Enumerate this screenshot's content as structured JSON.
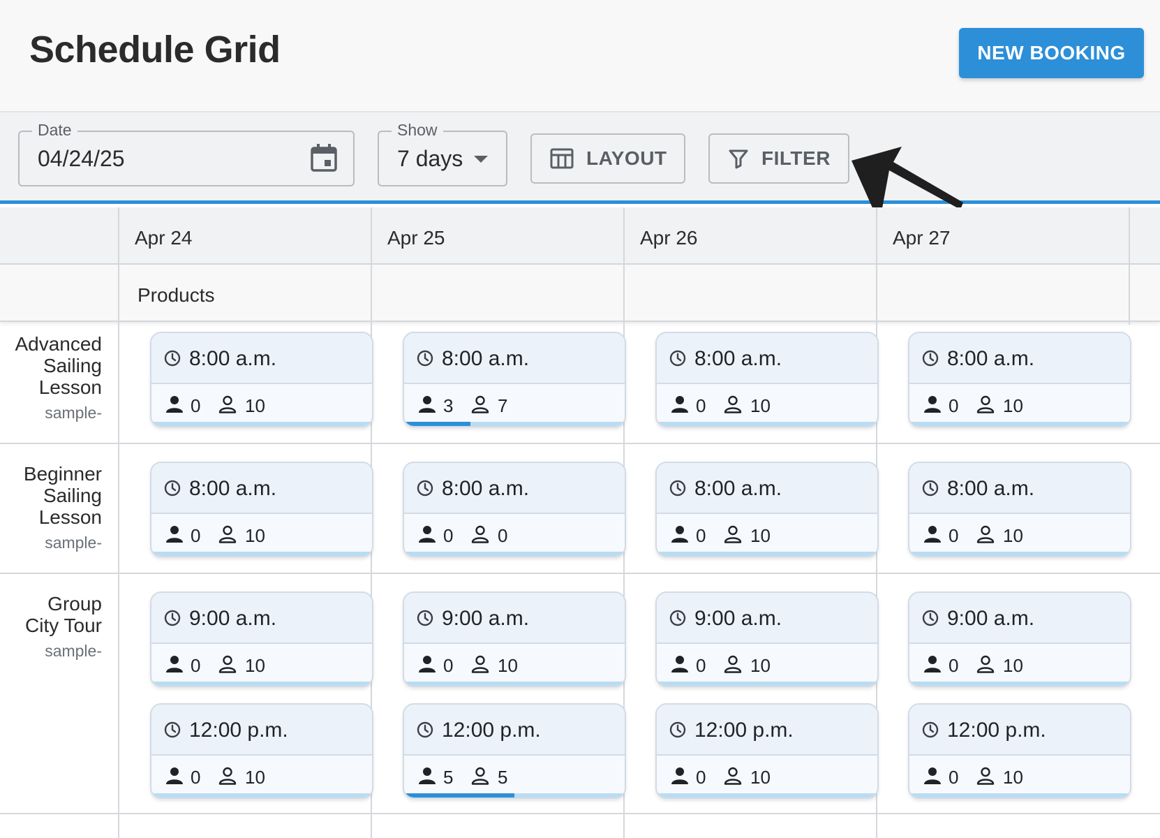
{
  "header": {
    "title": "Schedule Grid",
    "new_booking_label": "NEW BOOKING"
  },
  "toolbar": {
    "date_label": "Date",
    "date_value": "04/24/25",
    "show_label": "Show",
    "show_value": "7 days",
    "layout_label": "LAYOUT",
    "filter_label": "FILTER"
  },
  "grid": {
    "days": [
      "Apr 24",
      "Apr 25",
      "Apr 26",
      "Apr 27"
    ],
    "products_label": "Products",
    "products": [
      {
        "name_lines": [
          "Advanced",
          "Sailing",
          "Lesson"
        ],
        "sub": "sample-"
      },
      {
        "name_lines": [
          "Beginner",
          "Sailing",
          "Lesson"
        ],
        "sub": "sample-"
      },
      {
        "name_lines": [
          "Group",
          "City Tour"
        ],
        "sub": "sample-"
      }
    ],
    "slots": [
      [
        {
          "time": "8:00 a.m.",
          "booked": "0",
          "available": "10",
          "fill": 0
        },
        {
          "time": "8:00 a.m.",
          "booked": "3",
          "available": "7",
          "fill": 0.3
        },
        {
          "time": "8:00 a.m.",
          "booked": "0",
          "available": "10",
          "fill": 0
        },
        {
          "time": "8:00 a.m.",
          "booked": "0",
          "available": "10",
          "fill": 0
        }
      ],
      [
        {
          "time": "8:00 a.m.",
          "booked": "0",
          "available": "10",
          "fill": 0
        },
        {
          "time": "8:00 a.m.",
          "booked": "0",
          "available": "0",
          "fill": 0
        },
        {
          "time": "8:00 a.m.",
          "booked": "0",
          "available": "10",
          "fill": 0
        },
        {
          "time": "8:00 a.m.",
          "booked": "0",
          "available": "10",
          "fill": 0
        }
      ],
      [
        {
          "time": "9:00 a.m.",
          "booked": "0",
          "available": "10",
          "fill": 0
        },
        {
          "time": "9:00 a.m.",
          "booked": "0",
          "available": "10",
          "fill": 0
        },
        {
          "time": "9:00 a.m.",
          "booked": "0",
          "available": "10",
          "fill": 0
        },
        {
          "time": "9:00 a.m.",
          "booked": "0",
          "available": "10",
          "fill": 0
        }
      ],
      [
        {
          "time": "12:00 p.m.",
          "booked": "0",
          "available": "10",
          "fill": 0
        },
        {
          "time": "12:00 p.m.",
          "booked": "5",
          "available": "5",
          "fill": 0.5
        },
        {
          "time": "12:00 p.m.",
          "booked": "0",
          "available": "10",
          "fill": 0
        },
        {
          "time": "12:00 p.m.",
          "booked": "0",
          "available": "10",
          "fill": 0
        }
      ]
    ]
  },
  "colors": {
    "accent": "#2c8fd8",
    "card_bg": "#f6f9fd",
    "card_header": "#ecf2fa",
    "bar_track": "#b9dcf2"
  },
  "icons": [
    "calendar-icon",
    "caret-down-icon",
    "table-layout-icon",
    "filter-icon",
    "clock-icon",
    "person-filled-icon",
    "person-outline-icon",
    "pointer-arrow-icon"
  ]
}
